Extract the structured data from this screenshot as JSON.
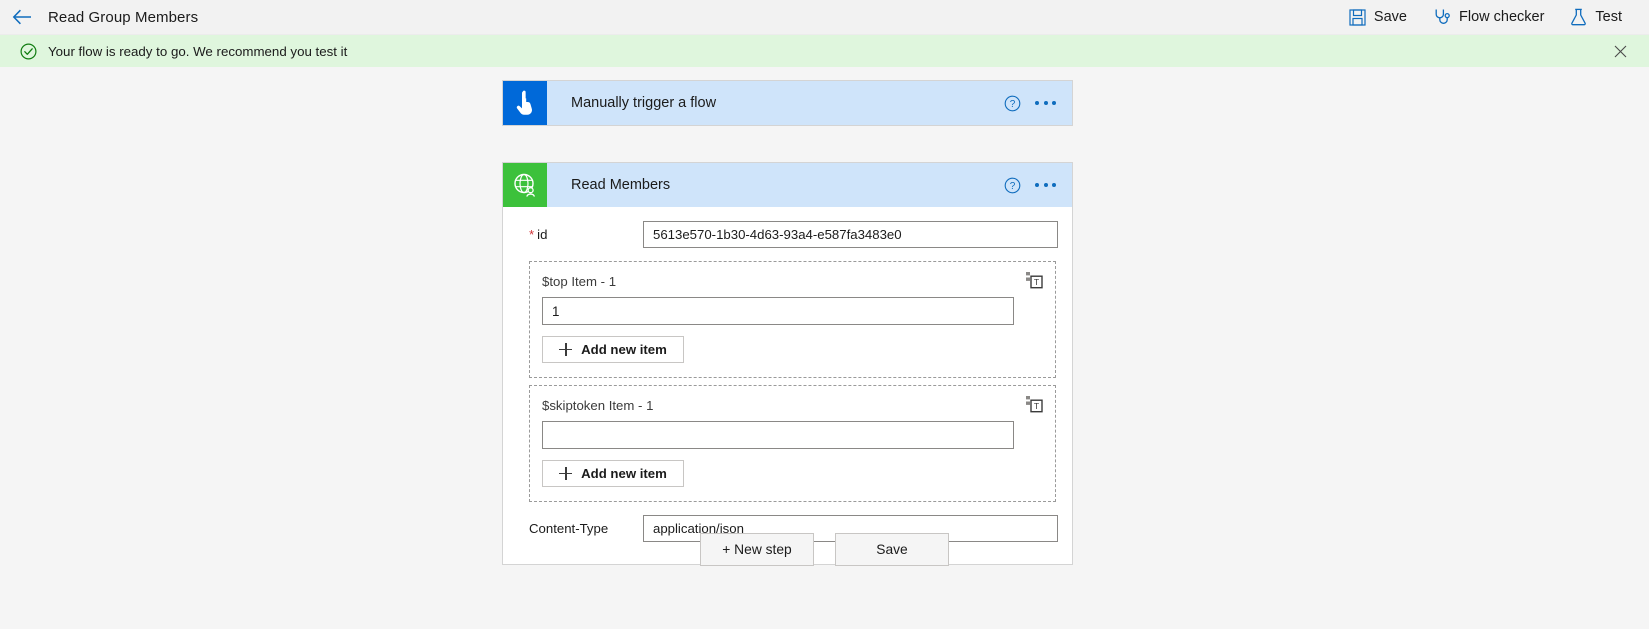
{
  "header": {
    "back_icon": "arrow-left-icon",
    "title": "Read Group Members",
    "actions": [
      {
        "label": "Save",
        "icon": "save-floppy-icon"
      },
      {
        "label": "Flow checker",
        "icon": "stethoscope-icon"
      },
      {
        "label": "Test",
        "icon": "flask-icon"
      }
    ]
  },
  "notification": {
    "icon": "check-circle-icon",
    "message": "Your flow is ready to go. We recommend you test it",
    "close_icon": "close-icon",
    "background_color": "#dff6dd"
  },
  "trigger_card": {
    "icon": "manual-trigger-hand-icon",
    "icon_tile_color": "#0069d9",
    "title": "Manually trigger a flow",
    "help_icon": "help-circle-icon",
    "menu_icon": "ellipsis-icon"
  },
  "action_card": {
    "icon": "globe-person-icon",
    "icon_tile_color": "#3cc13b",
    "title": "Read Members",
    "help_icon": "help-circle-icon",
    "menu_icon": "ellipsis-icon",
    "fields": {
      "id": {
        "label": "id",
        "required": true,
        "value": "5613e570-1b30-4d63-93a4-e587fa3483e0"
      },
      "top": {
        "label": "$top Item - 1",
        "value": "1",
        "add_label": "Add new item",
        "mode_icon": "text-mode-icon"
      },
      "skiptoken": {
        "label": "$skiptoken Item - 1",
        "value": "",
        "add_label": "Add new item",
        "mode_icon": "text-mode-icon"
      },
      "content_type": {
        "label": "Content-Type",
        "value": "application/json"
      }
    }
  },
  "footer": {
    "new_step_label": "+ New step",
    "save_label": "Save"
  },
  "theme": {
    "accent": "#0f6cbd",
    "card_header_bg": "#cfe4fa",
    "canvas_bg": "#f5f5f5",
    "cursor_color": "#0b6bf2"
  }
}
